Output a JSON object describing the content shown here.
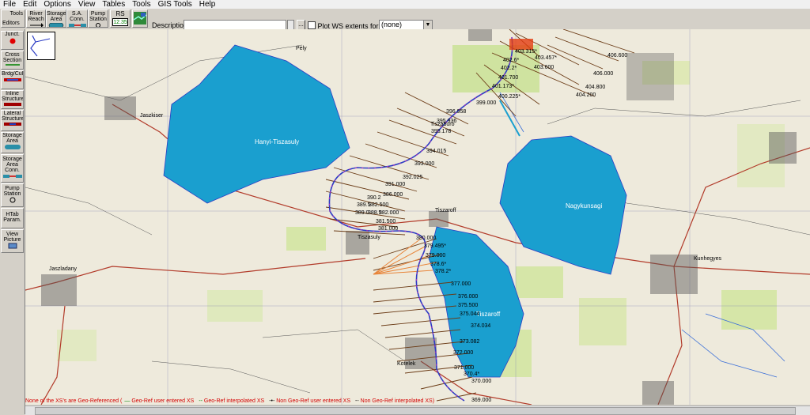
{
  "menu": [
    "File",
    "Edit",
    "Options",
    "View",
    "Tables",
    "Tools",
    "GIS Tools",
    "Help"
  ],
  "toolbar": {
    "tools_label": "Tools",
    "editors_label": "Editors",
    "river_reach": "River Reach",
    "storage_area": "Storage Area",
    "sa_conn": "S.A. Conn.",
    "pump_station": "Pump Station",
    "rs_label": "RS",
    "rs_value": "12.35",
    "description_label": "Description :",
    "description_value": "",
    "dots_label": "...",
    "plot_ws_label": "Plot WS extents for Profile:",
    "profile_value": "(none)"
  },
  "palette": [
    {
      "label": "Junct.",
      "icon": "junction-icon"
    },
    {
      "label": "Cross Section",
      "icon": "cross-section-icon"
    },
    {
      "label": "Brdg/Culv",
      "icon": "bridge-icon"
    },
    {
      "label": "Inline Structure",
      "icon": "inline-structure-icon"
    },
    {
      "label": "Lateral Structure",
      "icon": "lateral-structure-icon"
    },
    {
      "label": "Storage Area",
      "icon": "storage-area-icon"
    },
    {
      "label": "Storage Area Conn.",
      "icon": "storage-area-conn-icon"
    },
    {
      "label": "Pump Station",
      "icon": "pump-station-icon"
    },
    {
      "label": "HTab Param.",
      "icon": "htab-icon"
    },
    {
      "label": "View Picture",
      "icon": "view-picture-icon"
    }
  ],
  "storage_areas": [
    "Hanyi-Tiszasuly",
    "Nagykunsagi",
    "Tiszaroff"
  ],
  "cross_sections": [
    "403.315*",
    "402.6*",
    "403.457*",
    "402.2*",
    "403.600",
    "401.700",
    "401.173*",
    "400.225*",
    "399.000",
    "406.600",
    "406.000",
    "404.800",
    "404.200",
    "396.958",
    "395.936",
    "395.178",
    "394.015",
    "393.000",
    "392.025",
    "391.000",
    "390.2",
    "386.000",
    "389.5",
    "382.500",
    "389.0",
    "388.5",
    "382.000",
    "381.500",
    "381.000",
    "380.000",
    "379.495*",
    "379.000",
    "378.6*",
    "378.2*",
    "377.000",
    "376.000",
    "375.500",
    "375.044",
    "374.034",
    "373.082",
    "372.000",
    "371.000",
    "370.4*",
    "370.000",
    "369.000"
  ],
  "map_labels": [
    "Tiszaroff",
    "Jaszkiser",
    "Pely",
    "Tiszaburo",
    "Tiszasuly",
    "Kunhegyes",
    "Jaszladany",
    "Kotelek"
  ],
  "status": {
    "msg": "None of the XS's are Geo-Referenced (",
    "legend1": "Geo-Ref user entered XS",
    "legend2": "Geo-Ref interpolated XS",
    "legend3": "Non Geo-Ref user entered XS",
    "legend4": "Non Geo-Ref interpolated XS)"
  },
  "colors": {
    "storage_fill": "#1a9fcf",
    "river_line": "#2b3cc4",
    "xs_line": "#6b3b16",
    "xs_orange": "#e8853a",
    "status_red": "#d40000",
    "map_bg": "#eeeadc"
  }
}
